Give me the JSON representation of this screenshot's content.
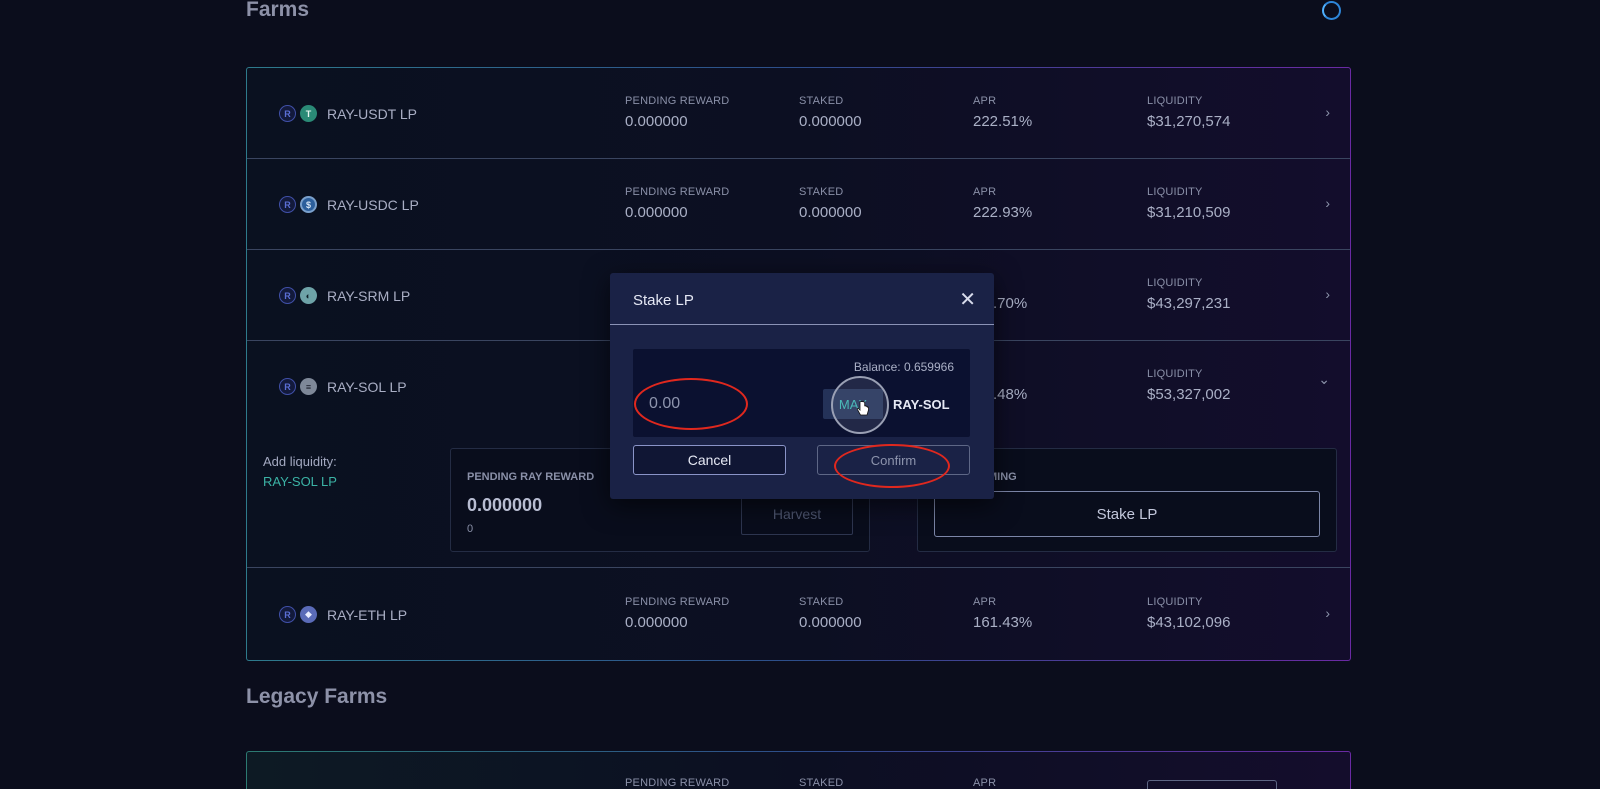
{
  "page": {
    "title": "Farms",
    "legacy_title": "Legacy Farms"
  },
  "columns": {
    "pending_reward": "PENDING REWARD",
    "staked": "STAKED",
    "apr": "APR",
    "liquidity": "LIQUIDITY"
  },
  "farms": [
    {
      "name": "RAY-USDT LP",
      "coin": "T",
      "pending": "0.000000",
      "staked": "0.000000",
      "apr": "222.51%",
      "liquidity": "$31,270,574"
    },
    {
      "name": "RAY-USDC LP",
      "coin": "$",
      "pending": "0.000000",
      "staked": "0.000000",
      "apr": "222.93%",
      "liquidity": "$31,210,509"
    },
    {
      "name": "RAY-SRM LP",
      "coin": "◐",
      "apr_partial": ".70%",
      "liquidity": "$43,297,231"
    },
    {
      "name": "RAY-SOL LP",
      "coin": "≡",
      "apr_partial": ".48%",
      "liquidity": "$53,327,002"
    },
    {
      "name": "RAY-ETH LP",
      "coin": "◆",
      "pending": "0.000000",
      "staked": "0.000000",
      "apr": "161.43%",
      "liquidity": "$43,102,096"
    }
  ],
  "ray_coin": "R",
  "expanded": {
    "add_liquidity_label": "Add liquidity:",
    "add_liquidity_link": "RAY-SOL LP",
    "pending_ray_label": "PENDING RAY REWARD",
    "pending_ray_value": "0.000000",
    "pending_ray_sub": "0",
    "harvest_label": "Harvest",
    "farming_label_partial": "MING",
    "stake_label": "Stake LP"
  },
  "modal": {
    "title": "Stake LP",
    "close_glyph": "✕",
    "balance": "Balance: 0.659966",
    "amount_placeholder": "0.00",
    "max_label": "MAX",
    "lp_symbol": "RAY-SOL",
    "cancel_label": "Cancel",
    "confirm_label": "Confirm"
  },
  "icons": {
    "chevron_right": "›",
    "chevron_down": "⌄"
  },
  "colors": {
    "background": "#0b0d1c",
    "modal_bg": "#1a2246",
    "accent_teal": "#3cc0ba",
    "annotation_red": "#e0281e"
  }
}
